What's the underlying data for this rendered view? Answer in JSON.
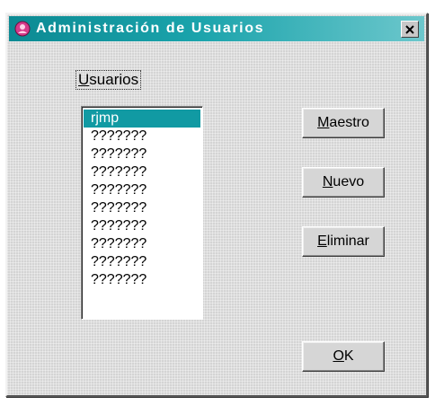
{
  "window": {
    "title": "Administración de Usuarios",
    "icon": "app-icon"
  },
  "group": {
    "label": "Usuarios",
    "mnemonic": "U",
    "rest": "suarios"
  },
  "users": {
    "items": [
      "rjmp",
      "???????",
      "???????",
      "???????",
      "???????",
      "???????",
      "???????",
      "???????",
      "???????",
      "???????"
    ],
    "selected_index": 0
  },
  "buttons": {
    "maestro": {
      "label": "Maestro",
      "mnemonic": "M",
      "rest": "aestro"
    },
    "nuevo": {
      "label": "Nuevo",
      "mnemonic": "N",
      "rest": "uevo"
    },
    "eliminar": {
      "label": "Eliminar",
      "mnemonic": "E",
      "rest": "liminar"
    },
    "ok": {
      "label": "OK",
      "mnemonic": "O",
      "rest": "K"
    }
  },
  "colors": {
    "titlebar_start": "#0c8a93",
    "titlebar_end": "#6cc7cc",
    "selection": "#119aa3",
    "dialog_bg": "#d4d4d4"
  }
}
